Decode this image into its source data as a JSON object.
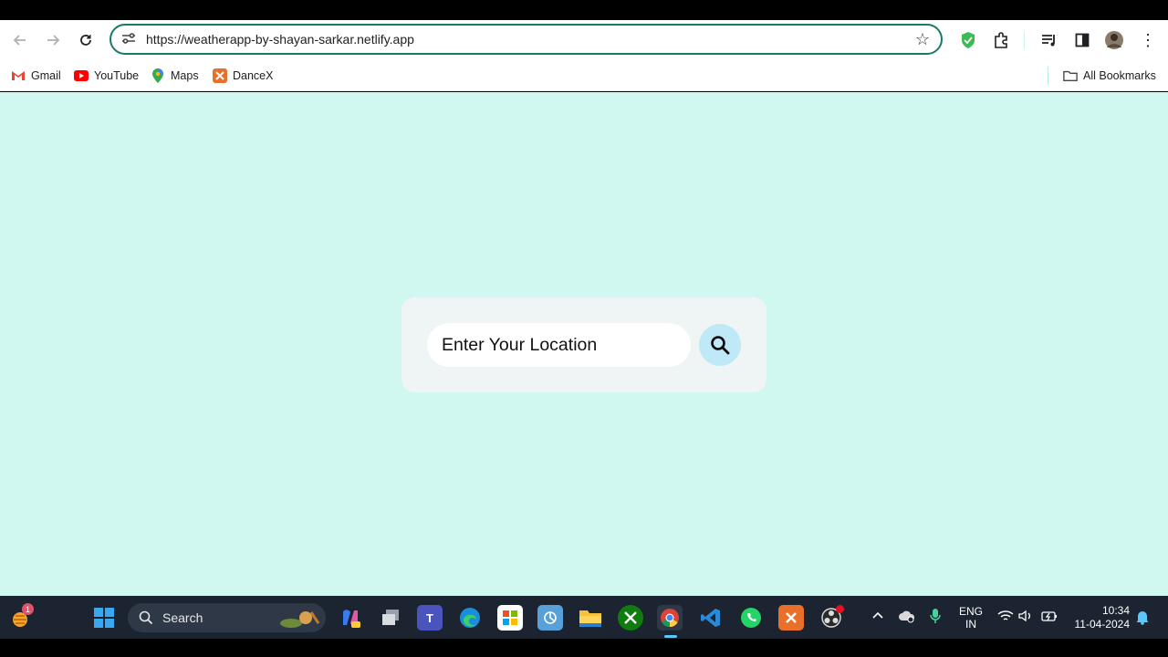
{
  "browser": {
    "url": "https://weatherapp-by-shayan-sarkar.netlify.app",
    "bookmarks": [
      {
        "label": "Gmail"
      },
      {
        "label": "YouTube"
      },
      {
        "label": "Maps"
      },
      {
        "label": "DanceX"
      }
    ],
    "all_bookmarks_label": "All Bookmarks"
  },
  "page": {
    "search_placeholder": "Enter Your Location"
  },
  "taskbar": {
    "search_label": "Search",
    "notification_count": "1",
    "language_line1": "ENG",
    "language_line2": "IN",
    "time": "10:34",
    "date": "11-04-2024"
  },
  "colors": {
    "page_bg": "#d0f7f0",
    "card_bg": "#eff4f4",
    "search_button_bg": "#bfe9f7",
    "omnibox_border": "#1a7a6a"
  }
}
